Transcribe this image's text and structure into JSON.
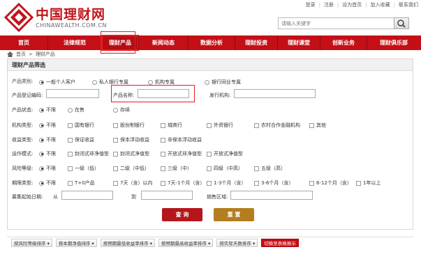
{
  "top_links": [
    "登录",
    "注册",
    "设为首页",
    "加入收藏",
    "联系我们"
  ],
  "logo": {
    "cn": "中国理财网",
    "en": "CHINAWEALTH.COM.CN"
  },
  "search": {
    "placeholder": "请输入关键字"
  },
  "nav": [
    "首页",
    "法律规范",
    "理财产品",
    "新闻动态",
    "数据分析",
    "理财投资",
    "理财课堂",
    "创新业务",
    "理财俱乐部"
  ],
  "breadcrumb": [
    "首页",
    "理财产品"
  ],
  "panel_title": "理财产品筛选",
  "rows": {
    "type": {
      "label": "产品类别:",
      "options": [
        "一般个人客户",
        "私人银行专属",
        "机构专属",
        "银行同业专属"
      ]
    },
    "code_label": "产品登记编码:",
    "name_label": "产品名称:",
    "issuer_label": "发行机构:",
    "status": {
      "label": "产品状态:",
      "options": [
        "不限",
        "在售",
        "存续"
      ]
    },
    "inst": {
      "label": "机构类型:",
      "options": [
        "不限",
        "国有银行",
        "股份制银行",
        "城商行",
        "外资银行",
        "农村合作金融机构",
        "其他"
      ]
    },
    "income": {
      "label": "收益类型:",
      "options": [
        "不限",
        "保证收益",
        "保本浮动收益",
        "非保本浮动收益"
      ]
    },
    "mode": {
      "label": "运作模式:",
      "options": [
        "不限",
        "封闭式非净值型",
        "封闭式净值型",
        "开放式非净值型",
        "开放式净值型"
      ]
    },
    "risk": {
      "label": "风险等级:",
      "options": [
        "不限",
        "一级（低）",
        "二级（中低）",
        "三级（中）",
        "四级（中高）",
        "五级（高）"
      ]
    },
    "term": {
      "label": "期限类型:",
      "options": [
        "不限",
        "T+0产品",
        "7天（含）以内",
        "7天-1个月（含）",
        "1-3个月（含）",
        "3-6个月（含）",
        "6-12个月（含）",
        "1年以上"
      ]
    },
    "date": {
      "label": "募集起始日期:",
      "from": "从",
      "to": "到"
    },
    "region_label": "销售区域:"
  },
  "buttons": {
    "query": "查 询",
    "reset": "重 置"
  },
  "sort": [
    "按风险等级排序 ▾",
    "按本期净值排序 ▾",
    "按预期最低收益率排序 ▾",
    "按预期最高收益率排序 ▾",
    "按实际天数排序 ▾",
    "切换至表格展示"
  ],
  "colors": {
    "brand_red": "#c40f16",
    "highlight": "#e31b23",
    "reset_gold": "#b57d1f"
  }
}
